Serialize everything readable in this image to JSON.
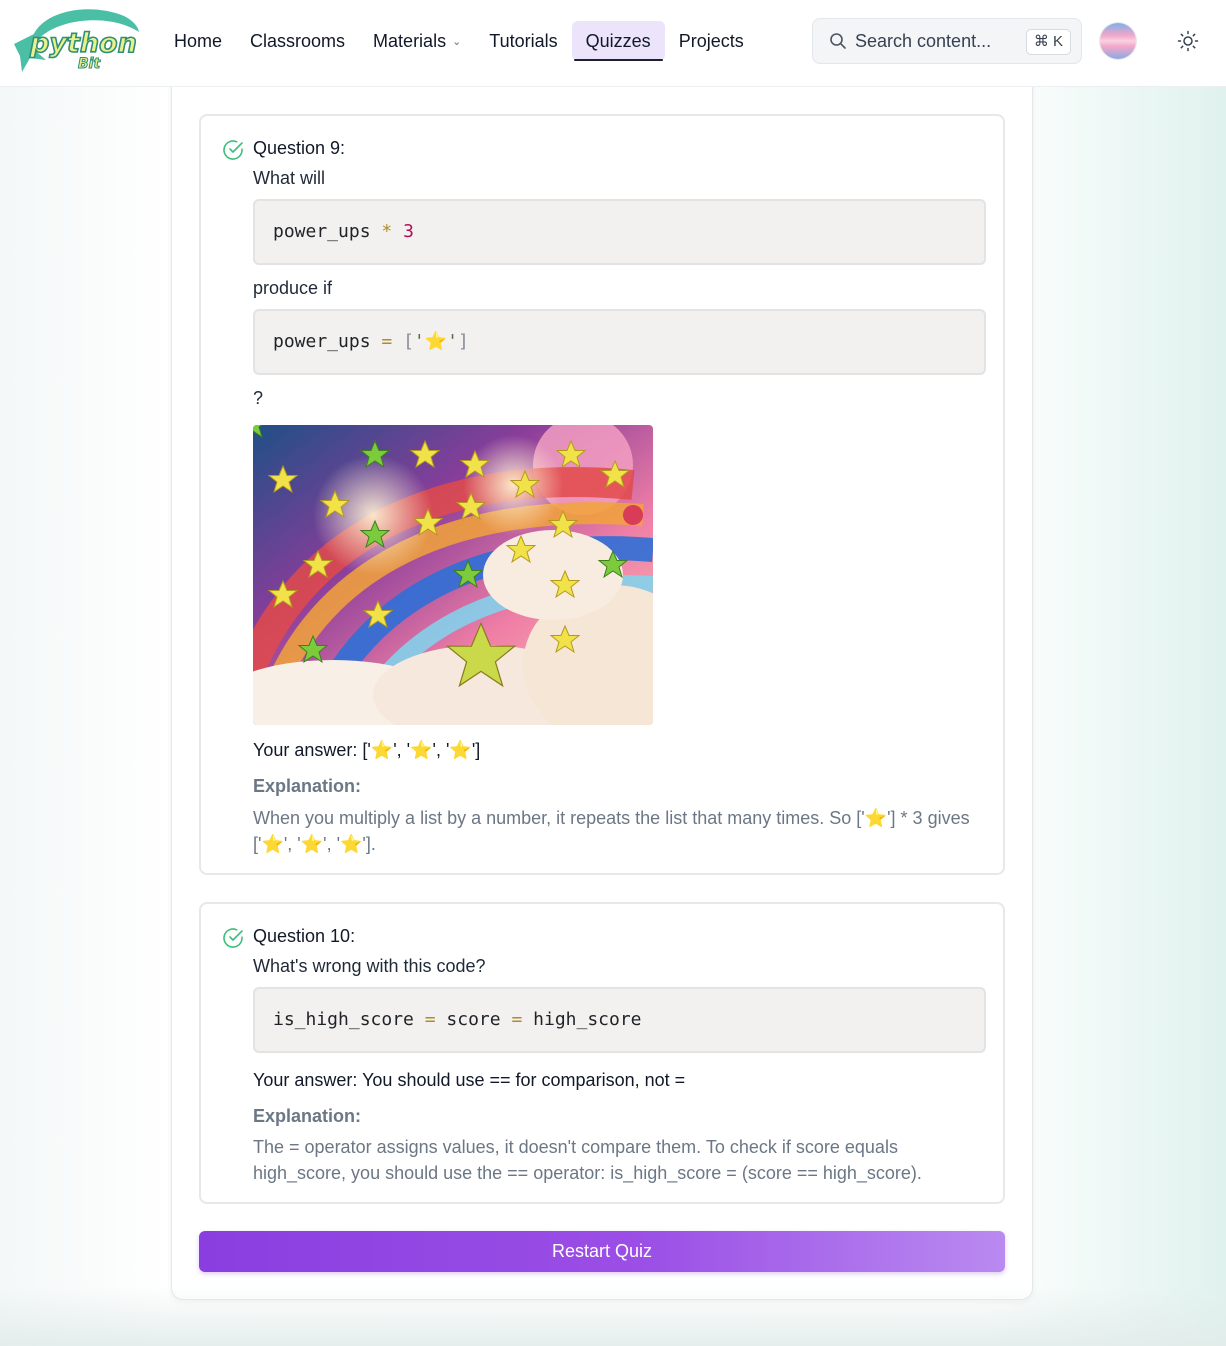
{
  "header": {
    "logo": {
      "word": "python",
      "sub": "Bit"
    },
    "nav": [
      {
        "label": "Home"
      },
      {
        "label": "Classrooms"
      },
      {
        "label": "Materials",
        "has_dropdown": true
      },
      {
        "label": "Tutorials"
      },
      {
        "label": "Quizzes",
        "active": true
      },
      {
        "label": "Projects"
      }
    ],
    "search": {
      "placeholder": "Search content...",
      "shortcut": "⌘ K",
      "icon": "search-icon"
    },
    "theme_toggle_icon": "sun-icon"
  },
  "questions": [
    {
      "title": "Question 9:",
      "status": "correct",
      "prompt_before": "What will",
      "code1": {
        "ident": "power_ups",
        "op": "*",
        "num": "3"
      },
      "prompt_middle": "produce if",
      "code2": {
        "ident": "power_ups",
        "op": "=",
        "open": "[",
        "str": "'⭐'",
        "close": "]"
      },
      "prompt_after": "?",
      "answer": "Your answer: ['⭐', '⭐', '⭐']",
      "explanation_label": "Explanation:",
      "explanation": "When you multiply a list by a number, it repeats the list that many times. So ['⭐'] * 3 gives ['⭐', '⭐', '⭐']."
    },
    {
      "title": "Question 10:",
      "status": "correct",
      "prompt_before": "What's wrong with this code?",
      "code1": {
        "a": "is_high_score",
        "op1": "=",
        "b": "score",
        "op2": "=",
        "c": "high_score"
      },
      "answer": "Your answer: You should use == for comparison, not =",
      "explanation_label": "Explanation:",
      "explanation": "The = operator assigns values, it doesn't compare them. To check if score equals high_score, you should use the == operator: is_high_score = (score == high_score)."
    }
  ],
  "restart_label": "Restart Quiz",
  "colors": {
    "accent": "#8a3ee0",
    "active_nav_bg": "#ece4fb",
    "check_green": "#3bbf7a",
    "explanation_text": "#6b7785"
  }
}
